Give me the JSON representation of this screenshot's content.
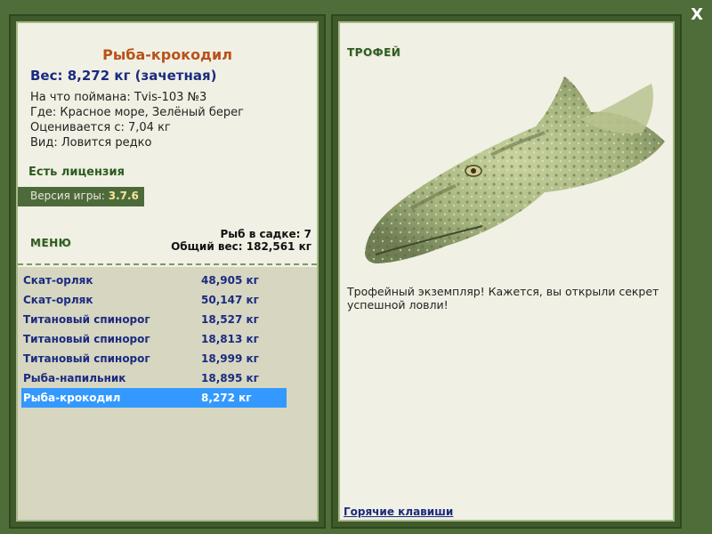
{
  "close_label": "X",
  "fish": {
    "title": "Рыба-крокодил",
    "weight_line": "Вес: 8,272 кг (зачетная)",
    "caught_with": "На что поймана: Tvis-103 №3",
    "location": "Где: Красное море, Зелёный берег",
    "value_from": "Оценивается с: 7,04 кг",
    "species": "Вид: Ловится редко"
  },
  "license_text": "Есть лицензия",
  "version": {
    "label": "Версия игры: ",
    "value": "3.7.6"
  },
  "menu_label": "МЕНЮ",
  "cage": {
    "fish_count": "Рыб в садке: 7",
    "total_weight": "Общий вес: 182,561 кг"
  },
  "catch_list": [
    {
      "name": "Скат-орляк",
      "weight": "48,905 кг"
    },
    {
      "name": "Скат-орляк",
      "weight": "50,147 кг"
    },
    {
      "name": "Титановый спинорог",
      "weight": "18,527 кг"
    },
    {
      "name": "Титановый спинорог",
      "weight": "18,813 кг"
    },
    {
      "name": "Титановый спинорог",
      "weight": "18,999 кг"
    },
    {
      "name": "Рыба-напильник",
      "weight": "18,895 кг"
    },
    {
      "name": "Рыба-крокодил",
      "weight": "8,272 кг"
    }
  ],
  "selected_index": 6,
  "trophy_label": "ТРОФЕЙ",
  "trophy_text": "Трофейный экземпляр! Кажется, вы открыли секрет успешной ловли!",
  "hotkeys_label": "Горячие клавиши",
  "colors": {
    "background": "#4f6d38",
    "panel": "#f1f0e4",
    "list_background": "#d7d6c1",
    "selection": "#3399ff",
    "title": "#b8521a",
    "link": "#1a2b80"
  }
}
